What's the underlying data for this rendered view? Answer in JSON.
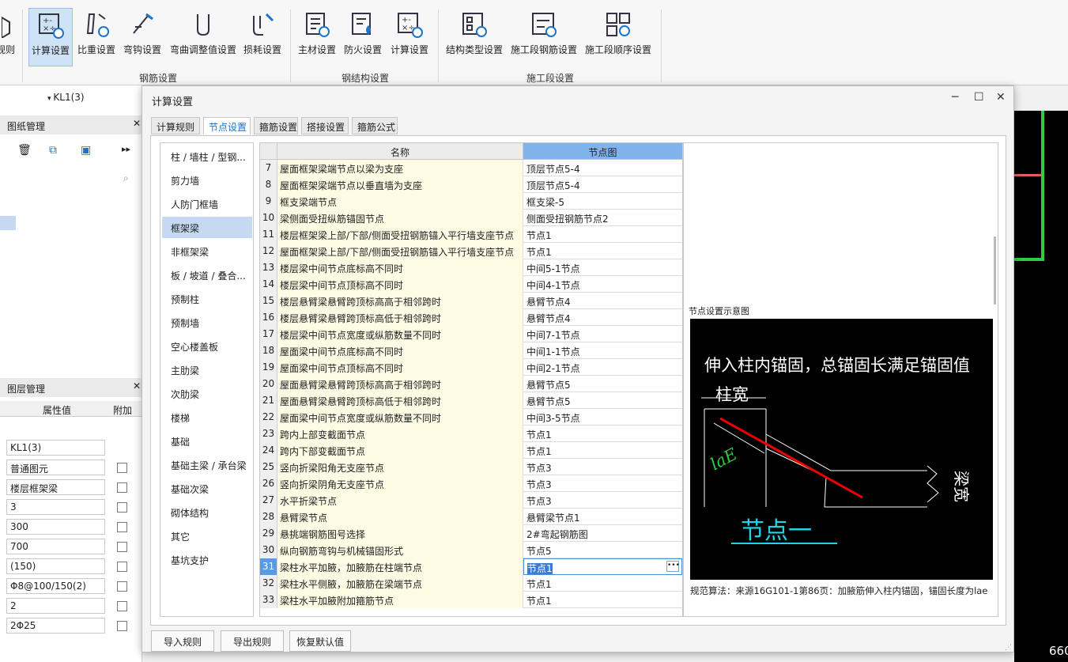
{
  "ribbon": {
    "buttons": [
      "计算设置",
      "比重设置",
      "弯钩设置",
      "弯曲调整值设置",
      "损耗设置",
      "主材设置",
      "防火设置",
      "计算设置",
      "结构类型设置",
      "施工段钢筋设置",
      "施工段顺序设置"
    ],
    "left_cut": "规则",
    "groups": [
      "钢筋设置",
      "钢结构设置",
      "施工段设置"
    ]
  },
  "left": {
    "combo": "KL1(3)",
    "drawing_panel": "图纸管理",
    "layer_panel": "图层管理",
    "col_value": "属性值",
    "col_extra": "附加",
    "values": [
      "KL1(3)",
      "普通图元",
      "楼层框架梁",
      "3",
      "300",
      "700",
      "(150)",
      "Φ8@100/150(2)",
      "2",
      "2Φ25"
    ]
  },
  "dialog": {
    "title": "计算设置",
    "tabs": [
      "计算规则",
      "节点设置",
      "箍筋设置",
      "搭接设置",
      "箍筋公式"
    ],
    "active_tab": 1,
    "categories": [
      "柱 / 墙柱 / 型钢...",
      "剪力墙",
      "人防门框墙",
      "框架梁",
      "非框架梁",
      "板 / 坡道 / 叠合...",
      "预制柱",
      "预制墙",
      "空心楼盖板",
      "主肋梁",
      "次肋梁",
      "楼梯",
      "基础",
      "基础主梁 / 承台梁",
      "基础次梁",
      "砌体结构",
      "其它",
      "基坑支护"
    ],
    "active_category": 3,
    "col_name": "名称",
    "col_node": "节点图",
    "rows": [
      [
        "7",
        "屋面框架梁端节点以梁为支座",
        "顶层节点5-4"
      ],
      [
        "8",
        "屋面框架梁端节点以垂直墙为支座",
        "顶层节点5-4"
      ],
      [
        "9",
        "框支梁端节点",
        "框支梁-5"
      ],
      [
        "10",
        "梁侧面受扭纵筋锚固节点",
        "侧面受扭钢筋节点2"
      ],
      [
        "11",
        "楼层框架梁上部/下部/侧面受扭钢筋锚入平行墙支座节点",
        "节点1"
      ],
      [
        "12",
        "屋面框架梁上部/下部/侧面受扭钢筋锚入平行墙支座节点",
        "节点1"
      ],
      [
        "13",
        "楼层梁中间节点底标高不同时",
        "中间5-1节点"
      ],
      [
        "14",
        "楼层梁中间节点顶标高不同时",
        "中间4-1节点"
      ],
      [
        "15",
        "楼层悬臂梁悬臂跨顶标高高于相邻跨时",
        "悬臂节点4"
      ],
      [
        "16",
        "楼层悬臂梁悬臂跨顶标高低于相邻跨时",
        "悬臂节点4"
      ],
      [
        "17",
        "楼层梁中间节点宽度或纵筋数量不同时",
        "中间7-1节点"
      ],
      [
        "18",
        "屋面梁中间节点底标高不同时",
        "中间1-1节点"
      ],
      [
        "19",
        "屋面梁中间节点顶标高不同时",
        "中间2-1节点"
      ],
      [
        "20",
        "屋面悬臂梁悬臂跨顶标高高于相邻跨时",
        "悬臂节点5"
      ],
      [
        "21",
        "屋面悬臂梁悬臂跨顶标高低于相邻跨时",
        "悬臂节点5"
      ],
      [
        "22",
        "屋面梁中间节点宽度或纵筋数量不同时",
        "中间3-5节点"
      ],
      [
        "23",
        "跨内上部变截面节点",
        "节点1"
      ],
      [
        "24",
        "跨内下部变截面节点",
        "节点1"
      ],
      [
        "25",
        "竖向折梁阳角无支座节点",
        "节点3"
      ],
      [
        "26",
        "竖向折梁阴角无支座节点",
        "节点3"
      ],
      [
        "27",
        "水平折梁节点",
        "节点3"
      ],
      [
        "28",
        "悬臂梁节点",
        "悬臂梁节点1"
      ],
      [
        "29",
        "悬挑端钢筋图号选择",
        "2#弯起钢筋图"
      ],
      [
        "30",
        "纵向钢筋弯钩与机械锚固形式",
        "节点5"
      ],
      [
        "31",
        "梁柱水平加腋，加腋筋在柱端节点",
        "节点1"
      ],
      [
        "32",
        "梁柱水平侧腋，加腋筋在梁端节点",
        "节点1"
      ],
      [
        "33",
        "梁柱水平加腋附加箍筋节点",
        "节点1"
      ]
    ],
    "selected_row": 24,
    "preview_title": "节点设置示意图",
    "diagram": {
      "headline": "伸入柱内锚固，总锚固长满足锚固值",
      "col_width": "柱宽",
      "lae": "laE",
      "beam_width": "梁宽",
      "node": "节点一"
    },
    "note": "规范算法：来源16G101-1第86页：加腋筋伸入柱内锚固，锚固长度为lae",
    "buttons": [
      "导入规则",
      "导出规则",
      "恢复默认值"
    ]
  },
  "canvas": {
    "coord": "660"
  }
}
